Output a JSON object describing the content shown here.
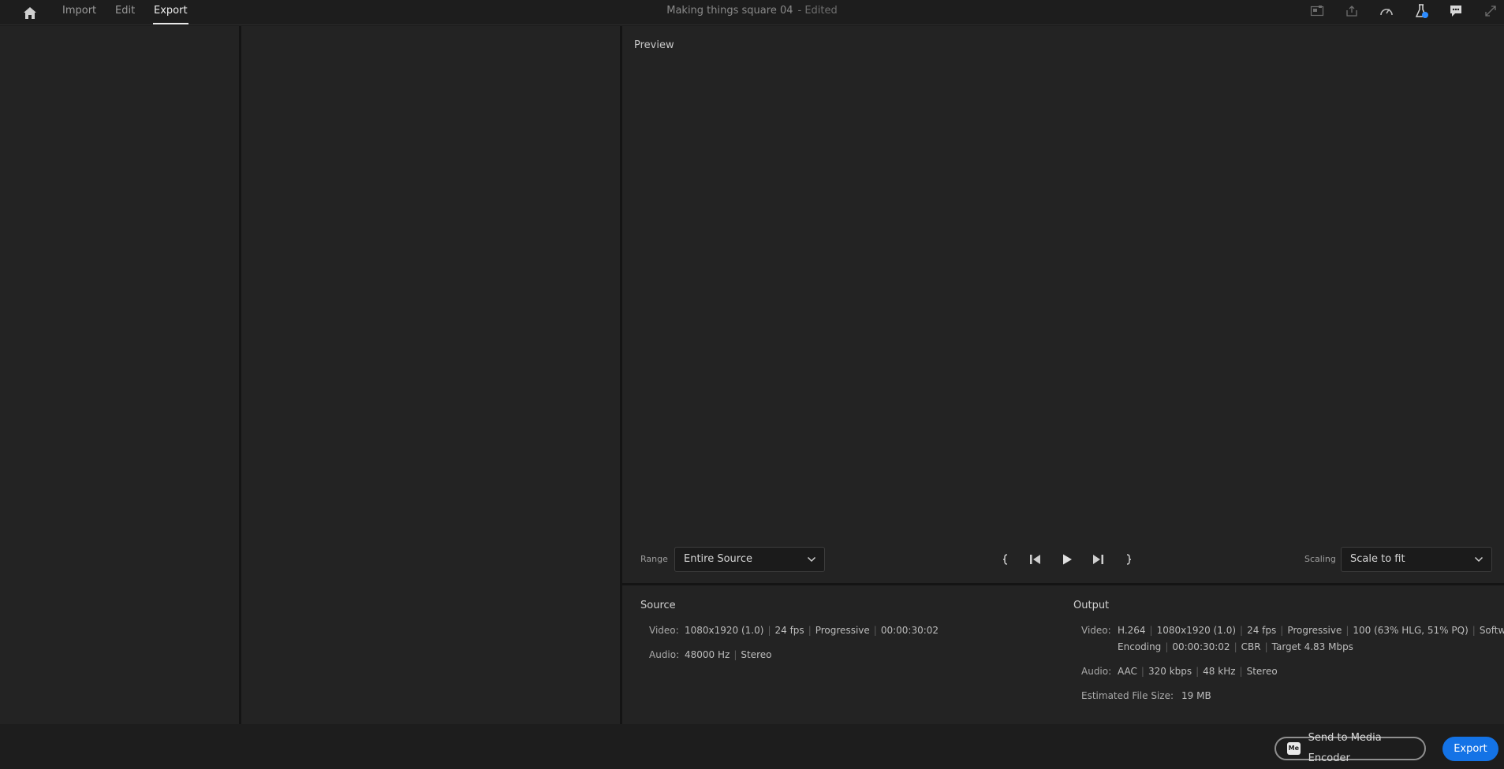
{
  "nav": {
    "tabs": [
      {
        "label": "Import"
      },
      {
        "label": "Edit"
      },
      {
        "label": "Export"
      }
    ],
    "active_tab": "Export"
  },
  "document": {
    "title": "Making things square 04",
    "status": "- Edited"
  },
  "preview": {
    "label": "Preview",
    "range_label": "Range",
    "range_value": "Entire Source",
    "scaling_label": "Scaling",
    "scaling_value": "Scale to fit"
  },
  "source": {
    "title": "Source",
    "video_label": "Video:",
    "video_values": [
      "1080x1920 (1.0)",
      "24 fps",
      "Progressive",
      "00:00:30:02"
    ],
    "audio_label": "Audio:",
    "audio_values": [
      "48000 Hz",
      "Stereo"
    ]
  },
  "output": {
    "title": "Output",
    "video_label": "Video:",
    "video_line1": [
      "H.264",
      "1080x1920 (1.0)",
      "24 fps",
      "Progressive",
      "100 (63% HLG, 51% PQ)",
      "Software"
    ],
    "video_line2": [
      "Encoding",
      "00:00:30:02",
      "CBR",
      "Target 4.83 Mbps"
    ],
    "audio_label": "Audio:",
    "audio_values": [
      "AAC",
      "320 kbps",
      "48 kHz",
      "Stereo"
    ],
    "size_label": "Estimated File Size:",
    "size_value": "19 MB"
  },
  "buttons": {
    "send_to_media_encoder": "Send to Media Encoder",
    "me_badge": "Me",
    "export": "Export"
  },
  "colors": {
    "accent": "#1473e6",
    "background": "#232323"
  },
  "icons": [
    "home-icon",
    "quick-export-icon",
    "share-icon",
    "performance-icon",
    "beta-flask-icon",
    "feedback-icon",
    "fullscreen-icon",
    "mark-in-icon",
    "step-back-icon",
    "play-icon",
    "step-forward-icon",
    "mark-out-icon",
    "chevron-down-icon"
  ]
}
